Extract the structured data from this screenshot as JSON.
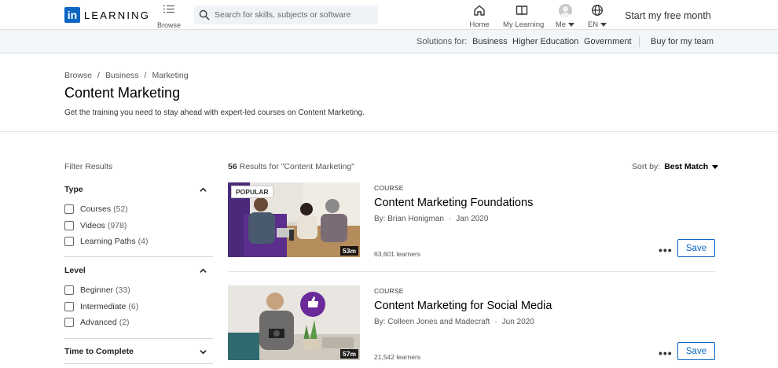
{
  "header": {
    "logo_in": "in",
    "logo_text": "LEARNING",
    "browse_label": "Browse",
    "search_placeholder": "Search for skills, subjects or software",
    "nav": [
      {
        "label": "Home",
        "icon": "home-icon"
      },
      {
        "label": "My Learning",
        "icon": "book-icon"
      },
      {
        "label": "Me",
        "icon": "avatar"
      },
      {
        "label": "EN",
        "icon": "globe-icon"
      }
    ],
    "cta": "Start my free month"
  },
  "subbar": {
    "solutions_label": "Solutions for:",
    "links": [
      "Business",
      "Higher Education",
      "Government"
    ],
    "buy": "Buy for my team"
  },
  "hero": {
    "breadcrumb": [
      "Browse",
      "Business",
      "Marketing"
    ],
    "breadcrumb_sep": "/",
    "title": "Content Marketing",
    "description": "Get the training you need to stay ahead with expert-led courses on Content Marketing."
  },
  "filters": {
    "title": "Filter Results",
    "groups": [
      {
        "heading": "Type",
        "options": [
          {
            "label": "Courses",
            "count": "(52)"
          },
          {
            "label": "Videos",
            "count": "(978)"
          },
          {
            "label": "Learning Paths",
            "count": "(4)"
          }
        ]
      },
      {
        "heading": "Level",
        "options": [
          {
            "label": "Beginner",
            "count": "(33)"
          },
          {
            "label": "Intermediate",
            "count": "(6)"
          },
          {
            "label": "Advanced",
            "count": "(2)"
          }
        ]
      },
      {
        "heading": "Time to Complete",
        "options": []
      }
    ]
  },
  "results": {
    "count": "56",
    "count_suffix": " Results for \"Content Marketing\"",
    "sort_label": "Sort by:",
    "sort_value": "Best Match",
    "cards": [
      {
        "badge": "POPULAR",
        "duration": "53m",
        "type": "COURSE",
        "title": "Content Marketing Foundations",
        "author": "By: Brian Honigman",
        "date": "Jan 2020",
        "learners": "63,601 learners",
        "more": "•••",
        "save": "Save"
      },
      {
        "badge": "",
        "duration": "57m",
        "type": "COURSE",
        "title": "Content Marketing for Social Media",
        "author": "By: Colleen Jones and Madecraft",
        "date": "Jun 2020",
        "learners": "21,542 learners",
        "more": "•••",
        "save": "Save"
      }
    ],
    "meta_sep": "·"
  },
  "colors": {
    "brand": "#0a66c2",
    "subbar_bg": "#f3f6f8",
    "search_bg": "#eef3f8",
    "thumb_purple": "#5b2d8c"
  }
}
